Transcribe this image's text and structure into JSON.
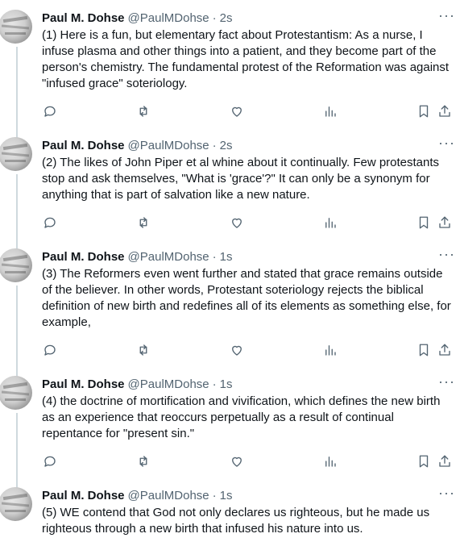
{
  "tweets": [
    {
      "name": "Paul M. Dohse",
      "handle": "@PaulMDohse",
      "time": "2s",
      "text": "(1) Here is a fun, but elementary fact about Protestantism: As a nurse, I infuse plasma and other things into a patient, and they become part of the person's chemistry. The fundamental protest of the Reformation was against \"infused grace\" soteriology."
    },
    {
      "name": "Paul M. Dohse",
      "handle": "@PaulMDohse",
      "time": "2s",
      "text": "(2) The likes of John Piper et al whine about it continually. Few protestants stop and ask themselves, \"What is 'grace'?\" It can only be a synonym for anything that is part of salvation like a new nature."
    },
    {
      "name": "Paul M. Dohse",
      "handle": "@PaulMDohse",
      "time": "1s",
      "text": "(3) The Reformers even went further and stated that grace remains outside of the believer. In other words, Protestant soteriology rejects the biblical definition of new birth and redefines all of its elements as something else, for example,"
    },
    {
      "name": "Paul M. Dohse",
      "handle": "@PaulMDohse",
      "time": "1s",
      "text": "(4) the doctrine of mortification and vivification, which defines the new birth as an experience that reoccurs perpetually as a result of continual repentance for \"present sin.\""
    },
    {
      "name": "Paul M. Dohse",
      "handle": "@PaulMDohse",
      "time": "1s",
      "text": "(5) WE contend that God not only declares us righteous, but he made us righteous through a new birth that infused his nature into us."
    }
  ],
  "separator": "·",
  "more_glyph": "···",
  "icons": [
    "reply-icon",
    "retweet-icon",
    "like-icon",
    "views-icon",
    "bookmark-icon",
    "share-icon"
  ],
  "colors": {
    "text": "#0f1419",
    "secondary": "#536471",
    "thread_line": "#cfd9de"
  }
}
